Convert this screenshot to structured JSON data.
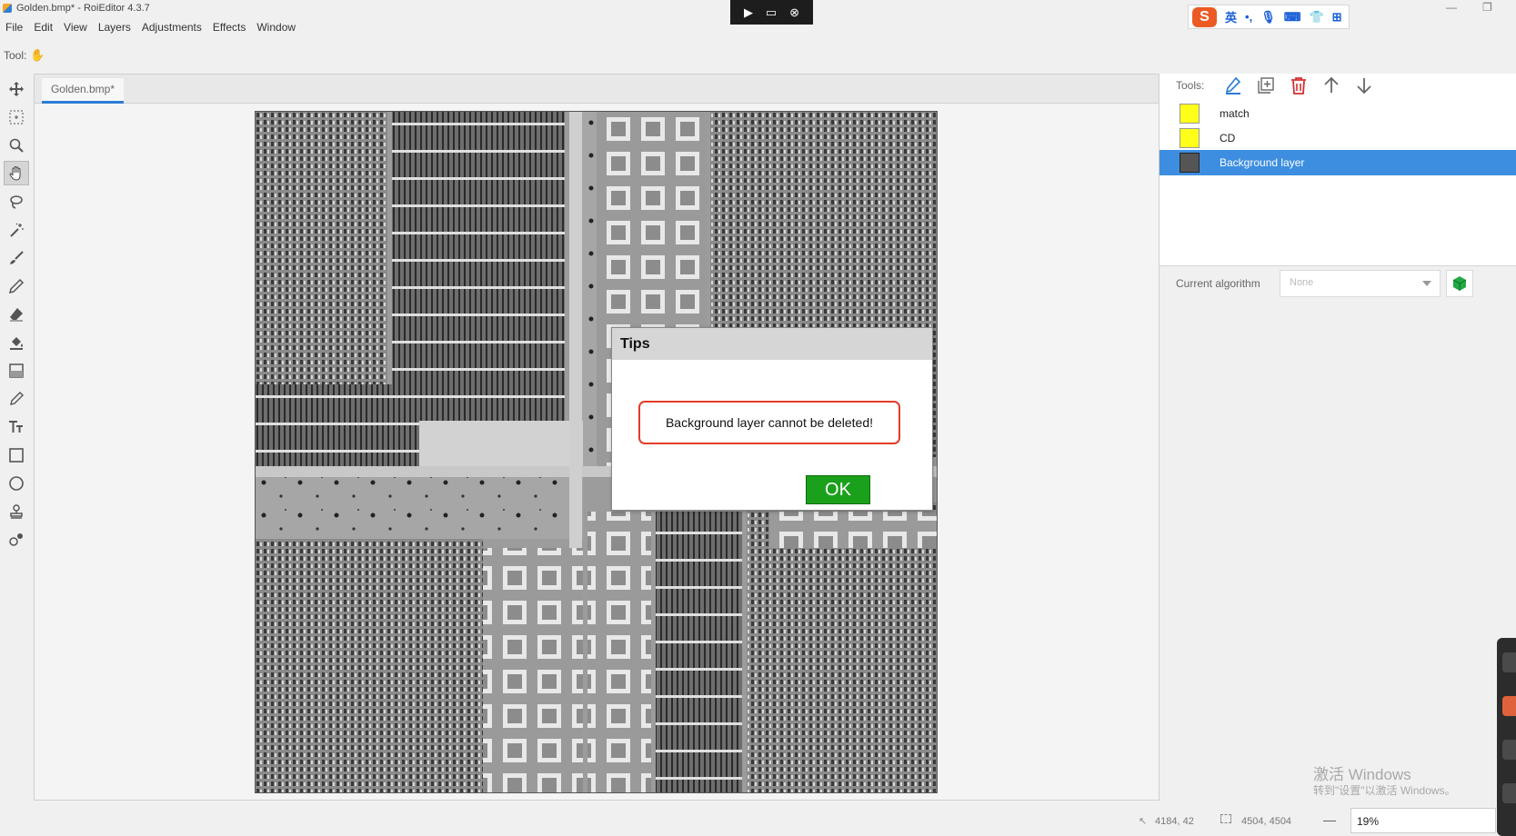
{
  "window": {
    "title": "Golden.bmp* - RoiEditor 4.3.7",
    "minimize_glyph": "—",
    "restore_glyph": "❐"
  },
  "recorder_bar": {
    "icons": [
      "play-cursor-icon",
      "screen-icon",
      "close-circle-icon"
    ],
    "glyphs": [
      "▶",
      "▭",
      "⊗"
    ]
  },
  "ime_bar": {
    "logo": "S",
    "mode": "英",
    "icons": [
      "punctuation-icon",
      "microphone-icon",
      "keyboard-icon",
      "shirt-icon",
      "grid-icon"
    ],
    "glyphs": [
      "•,",
      "🎙",
      "⌨",
      "👕",
      "⊞"
    ]
  },
  "menu": [
    "File",
    "Edit",
    "View",
    "Layers",
    "Adjustments",
    "Effects",
    "Window"
  ],
  "tool_row": {
    "label": "Tool:",
    "current_glyph": "✋"
  },
  "left_tools": [
    "move-icon",
    "marquee-icon",
    "zoom-icon",
    "hand-icon",
    "lasso-icon",
    "magic-wand-icon",
    "brush-icon",
    "pencil-icon",
    "eraser-icon",
    "fill-icon",
    "gradient-icon",
    "eyedropper-icon",
    "text-icon",
    "rectangle-icon",
    "ellipse-icon",
    "stamp-icon",
    "shapes-icon"
  ],
  "active_tool": "hand-icon",
  "document": {
    "tab": "Golden.bmp*"
  },
  "layers_panel": {
    "tools_label": "Tools:",
    "tool_icons": [
      "edit-icon",
      "add-layer-icon",
      "delete-icon",
      "move-up-icon",
      "move-down-icon"
    ],
    "tool_colors": [
      "#2b7cd3",
      "#666666",
      "#d32f2f",
      "#666666",
      "#666666"
    ],
    "layers": [
      {
        "name": "match",
        "selected": false
      },
      {
        "name": "CD",
        "selected": false
      },
      {
        "name": "Background layer",
        "selected": true
      }
    ]
  },
  "algorithm": {
    "label": "Current algorithm",
    "value": "None"
  },
  "status": {
    "cursor": "4184, 42",
    "size": "4504, 4504",
    "minus": "—",
    "zoom": "19%"
  },
  "watermark": {
    "line1": "激活 Windows",
    "line2": "转到\"设置\"以激活 Windows。"
  },
  "dialog": {
    "title": "Tips",
    "message": "Background layer cannot be deleted!",
    "ok": "OK"
  },
  "colors": {
    "accent": "#2b7cd3",
    "selection": "#3d8ee0",
    "ok_button": "#1ba01b",
    "message_border": "#e33b2a",
    "layer_swatch": "#ffff1a"
  }
}
